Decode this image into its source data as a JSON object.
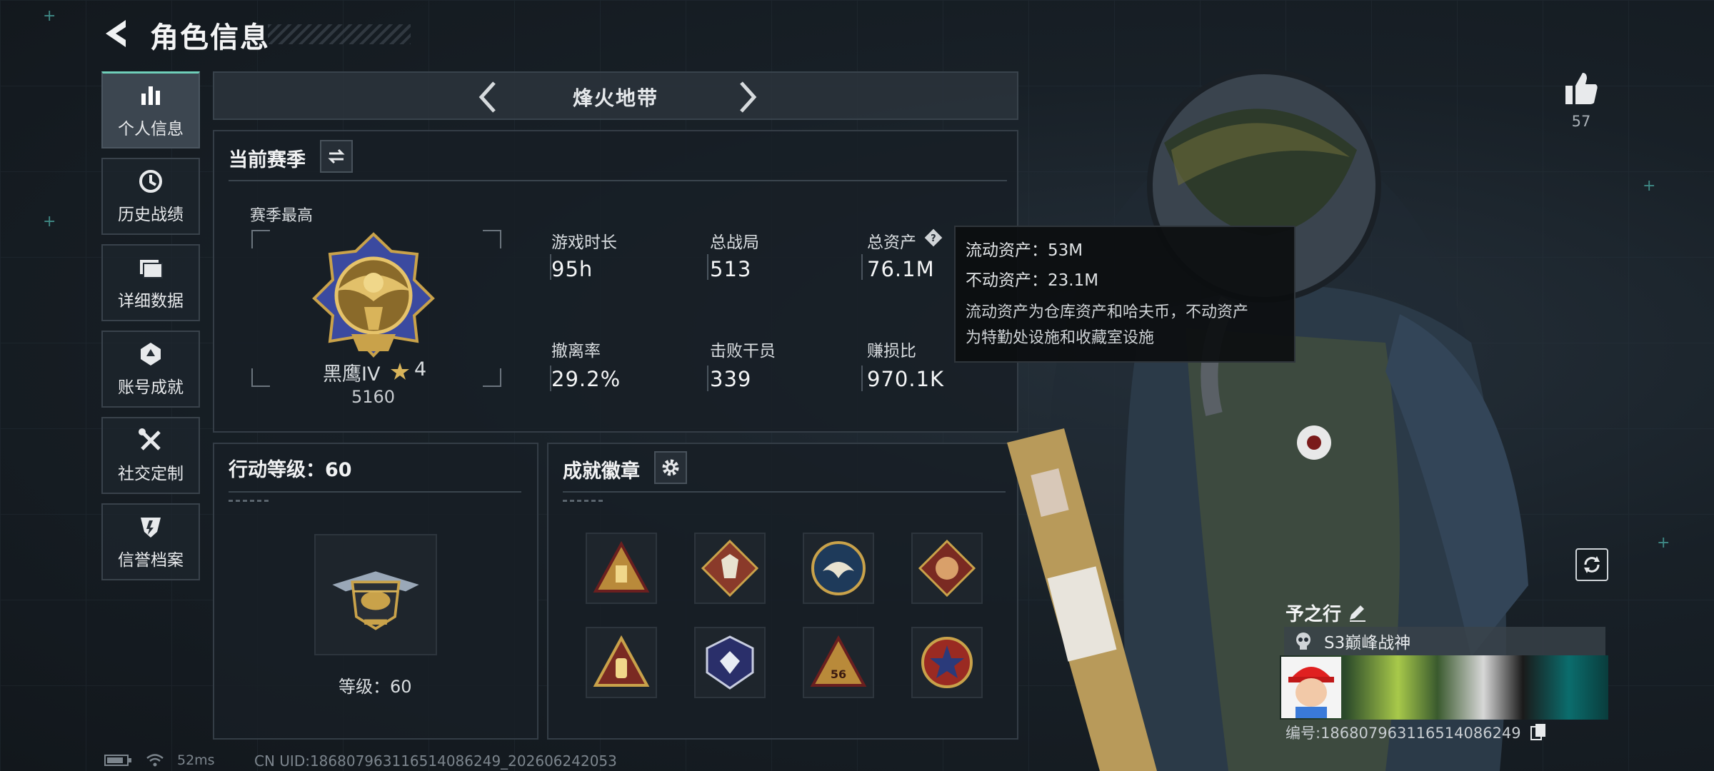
{
  "header": {
    "title": "角色信息"
  },
  "nav": {
    "items": [
      {
        "label": "个人信息",
        "icon": "bar-chart-icon",
        "active": true
      },
      {
        "label": "历史战绩",
        "icon": "clock-icon"
      },
      {
        "label": "详细数据",
        "icon": "folder-icon"
      },
      {
        "label": "账号成就",
        "icon": "achievement-icon"
      },
      {
        "label": "社交定制",
        "icon": "tools-icon"
      },
      {
        "label": "信誉档案",
        "icon": "shield-icon"
      }
    ]
  },
  "mode": {
    "name": "烽火地带"
  },
  "season": {
    "title": "当前赛季",
    "best_label": "赛季最高",
    "rank_name": "黑鹰IV",
    "rank_stars": "4",
    "rank_points": "5160",
    "stats": [
      {
        "label": "游戏时长",
        "value": "95h"
      },
      {
        "label": "总战局",
        "value": "513"
      },
      {
        "label": "总资产",
        "value": "76.1M"
      },
      {
        "label": "撤离率",
        "value": "29.2%"
      },
      {
        "label": "击败干员",
        "value": "339"
      },
      {
        "label": "赚损比",
        "value": "970.1K"
      }
    ]
  },
  "tooltip": {
    "liquid": "流动资产：53M",
    "fixed": "不动资产：23.1M",
    "desc_line1": "流动资产为仓库资产和哈夫币，不动资产",
    "desc_line2": "为特勤处设施和收藏室设施"
  },
  "action_level": {
    "title": "行动等级：60",
    "level_text": "等级：60"
  },
  "achievements": {
    "title": "成就徽章",
    "badges": [
      "triangle-badge",
      "wolf-badge",
      "eagle-badge",
      "dragon-badge",
      "hand-badge",
      "gem-badge",
      "number-56-badge",
      "star-badge"
    ]
  },
  "player": {
    "likes": "57",
    "name": "予之行",
    "title": "S3巅峰战神",
    "id_line": "编号:18680796311651408624​9"
  },
  "status_bar": {
    "ping": "52ms",
    "cn_uid": "CN UID:18680796311651408​6249_202606242053"
  },
  "colors": {
    "accent": "#6fcfb9",
    "panel": "#181f26",
    "gold": "#c9a24a"
  }
}
